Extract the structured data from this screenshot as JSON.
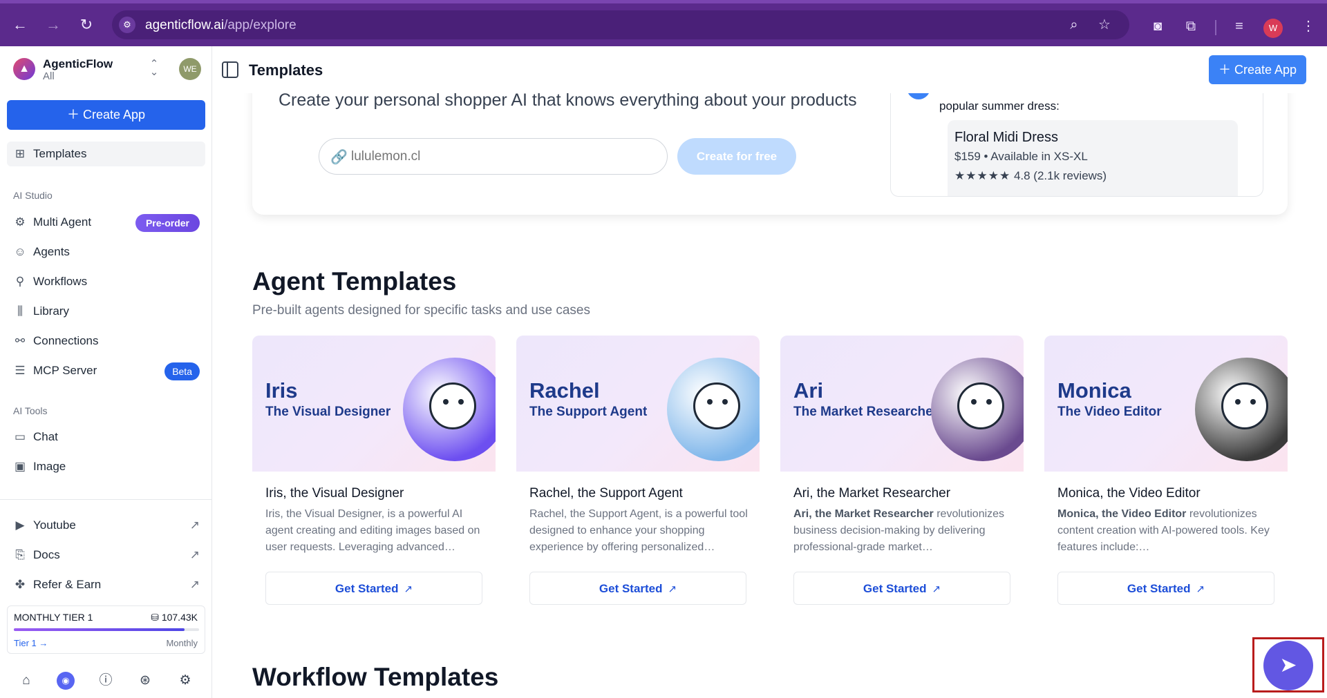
{
  "browser": {
    "url_host": "agenticflow.ai",
    "url_path": "/app/explore",
    "profile_initial": "W",
    "icons": [
      "back-icon",
      "forward-icon",
      "reload-icon",
      "site-settings-icon",
      "zoom-icon",
      "bookmark-star-icon",
      "camera-icon",
      "extensions-icon",
      "media-control-icon",
      "menu-dots-icon"
    ]
  },
  "sidebar": {
    "brand_name": "AgenticFlow",
    "brand_sub": "All",
    "workspace_avatar": "WE",
    "create_label": "Create App",
    "templates_label": "Templates",
    "ai_studio_heading": "AI Studio",
    "studio_items": [
      {
        "label": "Multi Agent",
        "icon": "multi-agent-icon",
        "badge": "Pre-order"
      },
      {
        "label": "Agents",
        "icon": "agents-icon"
      },
      {
        "label": "Workflows",
        "icon": "workflows-icon"
      },
      {
        "label": "Library",
        "icon": "library-icon"
      },
      {
        "label": "Connections",
        "icon": "connections-icon"
      },
      {
        "label": "MCP Server",
        "icon": "mcp-server-icon",
        "badge": "Beta"
      }
    ],
    "ai_tools_heading": "AI Tools",
    "tool_items": [
      {
        "label": "Chat",
        "icon": "chat-icon"
      },
      {
        "label": "Image",
        "icon": "image-icon"
      }
    ],
    "external_items": [
      {
        "label": "Youtube",
        "icon": "youtube-icon"
      },
      {
        "label": "Docs",
        "icon": "docs-icon"
      },
      {
        "label": "Refer & Earn",
        "icon": "gift-icon"
      }
    ],
    "tier": {
      "name": "MONTHLY TIER 1",
      "credits": "107.43K",
      "progress": 0.92,
      "link": "Tier 1 →",
      "period": "Monthly"
    },
    "footer_icons": [
      "home-icon",
      "discord-icon",
      "help-icon",
      "support-icon",
      "settings-icon"
    ]
  },
  "topbar": {
    "title": "Templates",
    "create_label": "Create App"
  },
  "hero": {
    "subtitle": "Create your personal shopper AI that knows everything about your products",
    "input_placeholder": "lululemon.cl",
    "button_label": "Create for free",
    "chat_line": "popular summer dress:",
    "product": {
      "name": "Floral Midi Dress",
      "meta": "$159 • Available in XS-XL",
      "stars": "★★★★★",
      "rating": "4.8 (2.1k reviews)"
    }
  },
  "agent_section": {
    "title": "Agent Templates",
    "subtitle": "Pre-built agents designed for specific tasks and use cases",
    "button_label": "Get Started",
    "cards": [
      {
        "name": "Iris",
        "role": "The Visual Designer",
        "title": "Iris, the Visual Designer",
        "desc_bold": "",
        "desc": "Iris, the Visual Designer, is a powerful AI agent creating and editing images based on user requests. Leveraging advanced…",
        "art_color": "#6d4ff0"
      },
      {
        "name": "Rachel",
        "role": "The Support Agent",
        "title": "Rachel, the Support Agent",
        "desc_bold": "",
        "desc": "Rachel, the Support Agent, is a powerful tool designed to enhance your shopping experience by offering personalized…",
        "art_color": "#7fb6ea"
      },
      {
        "name": "Ari",
        "role": "The Market Researcher",
        "title": "Ari, the Market Researcher",
        "desc_bold": "Ari, the Market Researcher",
        "desc": " revolutionizes business decision-making by delivering professional-grade market…",
        "art_color": "#6a4a8f"
      },
      {
        "name": "Monica",
        "role": "The Video Editor",
        "title": "Monica, the Video Editor",
        "desc_bold": "Monica, the Video Editor",
        "desc": " revolutionizes content creation with AI-powered tools. Key features include:…",
        "art_color": "#3a3a3a"
      }
    ]
  },
  "workflow_section": {
    "title": "Workflow Templates"
  },
  "fab_icon": "send-icon"
}
